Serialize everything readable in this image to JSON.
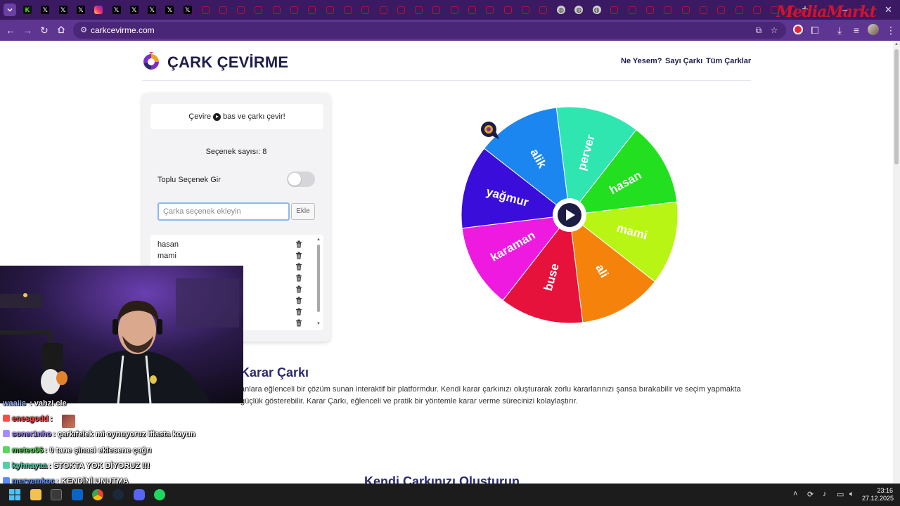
{
  "browser": {
    "url": "carkcevirme.com",
    "tab_icons": [
      "kick-icon",
      "x-icon",
      "x-icon",
      "x-icon",
      "instagram-icon",
      "x-icon",
      "x-icon",
      "x-icon",
      "x-icon",
      "x-icon",
      "mediamarkt-icon",
      "mediamarkt-icon",
      "mediamarkt-icon",
      "mediamarkt-icon",
      "mediamarkt-icon",
      "mediamarkt-icon",
      "mediamarkt-icon",
      "mediamarkt-icon",
      "mediamarkt-icon",
      "mediamarkt-icon",
      "mediamarkt-icon",
      "mediamarkt-icon",
      "mediamarkt-icon",
      "mediamarkt-icon",
      "mediamarkt-icon",
      "mediamarkt-icon",
      "mediamarkt-icon",
      "mediamarkt-icon",
      "mediamarkt-icon",
      "mediamarkt-icon",
      "globe-icon",
      "globe-icon",
      "globe-icon",
      "mediamarkt-icon",
      "mediamarkt-icon",
      "mediamarkt-icon",
      "mediamarkt-icon",
      "mediamarkt-icon",
      "mediamarkt-icon",
      "mediamarkt-icon",
      "mediamarkt-icon",
      "mediamarkt-icon",
      "mediamarkt-icon",
      "mediamarkt-icon"
    ],
    "active_tab_index": 44,
    "brand_overlay": "MediaMarkt",
    "accent_color": "#5e3591"
  },
  "site": {
    "title": "ÇARK ÇEVİRME",
    "nav": [
      "Ne Yesem?",
      "Sayı Çarkı",
      "Tüm Çarklar"
    ]
  },
  "panel": {
    "hint_before": "Çevire",
    "hint_after": "bas ve çarkı çevir!",
    "count_text": "Seçenek sayısı: 8",
    "bulk_label": "Toplu Seçenek Gir",
    "bulk_enabled": false,
    "input_placeholder": "Çarka seçenek ekleyin",
    "input_value": "",
    "add_label": "Ekle",
    "options": [
      "hasan",
      "mami",
      "",
      "",
      "",
      "",
      "",
      ""
    ]
  },
  "wheel": {
    "segments": [
      {
        "label": "perver",
        "color": "#2fe6b0"
      },
      {
        "label": "hasan",
        "color": "#22e020"
      },
      {
        "label": "mami",
        "color": "#b8f515"
      },
      {
        "label": "ali",
        "color": "#f5820a"
      },
      {
        "label": "buse",
        "color": "#e6123c"
      },
      {
        "label": "karaman",
        "color": "#ee1ae0"
      },
      {
        "label": "yağmur",
        "color": "#3a0ddb"
      },
      {
        "label": "alik",
        "color": "#1c86f0"
      }
    ],
    "pointer_color": "#e8a417"
  },
  "about": {
    "title": "Karar Çarkı",
    "text": "anlara eğlenceli bir çözüm sunan interaktif bir platformdur. Kendi karar çarkınızı oluşturarak zorlu kararlarınızı şansa bırakabilir ve seçim yapmakta güçlük göstere­bilir. Karar Çarkı, eğlenceli ve pratik bir yöntemle karar verme sürecinizi kolaylaştırır.",
    "section2": "Kendi Çarkınızı Oluşturun"
  },
  "chat": [
    {
      "user": "enesgodd",
      "msg": "",
      "color": "#ff4a4a",
      "emote": true
    },
    {
      "user": "soner1nho",
      "msg": "çarkıfelek mi oynuyoruz iflasta koyun",
      "color": "#a58bff"
    },
    {
      "user": "meteo96",
      "msg": "0 tane şinasi eklesene çağrı",
      "color": "#5cd65c"
    },
    {
      "user": "kyhnayaa",
      "msg": "STOKTA YOK DİYORUZ !!!",
      "color": "#4fd0a8"
    },
    {
      "user": "meryemkoc",
      "msg": "KENDİNİ UNUTMA",
      "color": "#5b8cff"
    }
  ],
  "taskbar": {
    "time": "23:16",
    "date": "27.12.2025"
  }
}
